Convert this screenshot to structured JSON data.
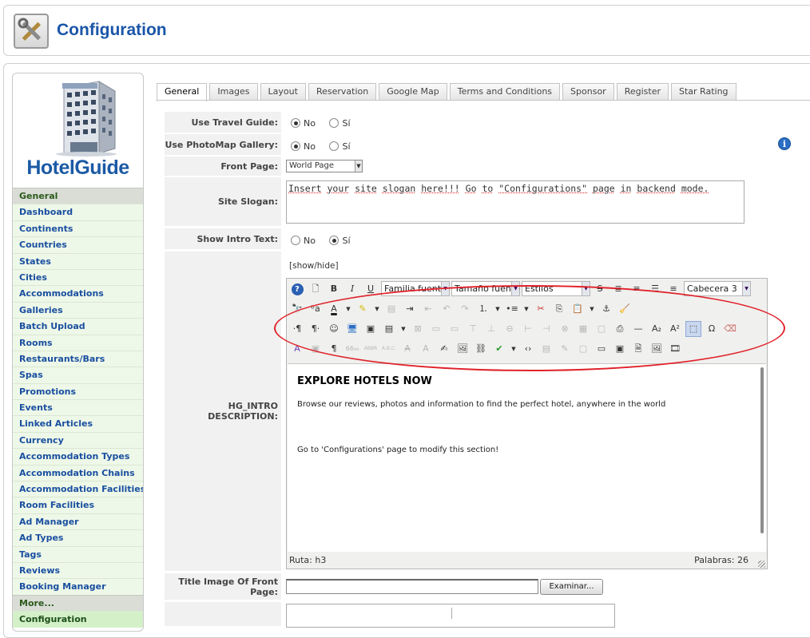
{
  "header": {
    "title": "Configuration",
    "icon": "tools-icon"
  },
  "sidebar": {
    "logo_text": "HotelGuide",
    "items": [
      {
        "label": "General",
        "type": "section"
      },
      {
        "label": "Dashboard"
      },
      {
        "label": "Continents"
      },
      {
        "label": "Countries"
      },
      {
        "label": "States"
      },
      {
        "label": "Cities"
      },
      {
        "label": "Accommodations"
      },
      {
        "label": "Galleries"
      },
      {
        "label": "Batch Upload"
      },
      {
        "label": "Rooms"
      },
      {
        "label": "Restaurants/Bars"
      },
      {
        "label": "Spas"
      },
      {
        "label": "Promotions"
      },
      {
        "label": "Events"
      },
      {
        "label": "Linked Articles"
      },
      {
        "label": "Currency"
      },
      {
        "label": "Accommodation Types"
      },
      {
        "label": "Accommodation Chains"
      },
      {
        "label": "Accommodation Facilities"
      },
      {
        "label": "Room Facilities"
      },
      {
        "label": "Ad Manager"
      },
      {
        "label": "Ad Types"
      },
      {
        "label": "Tags"
      },
      {
        "label": "Reviews"
      },
      {
        "label": "Booking Manager"
      },
      {
        "label": "More...",
        "type": "section"
      },
      {
        "label": "Configuration",
        "type": "active"
      }
    ]
  },
  "tabs": [
    "General",
    "Images",
    "Layout",
    "Reservation",
    "Google Map",
    "Terms and Conditions",
    "Sponsor",
    "Register",
    "Star Rating"
  ],
  "active_tab": "General",
  "form": {
    "travel_guide": {
      "label": "Use Travel Guide:",
      "no": "No",
      "yes": "Sí",
      "selected": "No"
    },
    "photomap": {
      "label": "Use PhotoMap Gallery:",
      "no": "No",
      "yes": "Sí",
      "selected": "No"
    },
    "front_page": {
      "label": "Front Page:",
      "value": "World Page"
    },
    "site_slogan": {
      "label": "Site Slogan:",
      "words": [
        "Insert",
        "your",
        "site",
        "slogan",
        "here!!!",
        "Go",
        "to",
        "\"Configurations\"",
        "page",
        "in",
        "backend",
        "mode."
      ]
    },
    "show_intro": {
      "label": "Show Intro Text:",
      "no": "No",
      "yes": "Sí",
      "selected": "Sí"
    },
    "intro_description": {
      "label": "HG_INTRO DESCRIPTION:",
      "show_hide": "[show/hide]"
    },
    "title_image": {
      "label": "Title Image Of Front Page:",
      "browse_label": "Examinar..."
    }
  },
  "editor": {
    "dropdowns": {
      "font_family": "Familia fuente",
      "font_size": "Tamaño fuente",
      "styles": "Estilos",
      "format": "Cabecera 3"
    },
    "content": {
      "heading": "EXPLORE HOTELS NOW",
      "paragraph1": "Browse our reviews, photos and information to find the perfect hotel, anywhere in the world",
      "paragraph2": "Go to 'Configurations' page to modify this section!"
    },
    "status": {
      "path": "Ruta:  h3",
      "words": "Palabras: 26"
    }
  },
  "colors": {
    "accent": "#1a56a8",
    "highlight_oval": "#e0222a",
    "sidebar_bg": "#eef8e8"
  }
}
